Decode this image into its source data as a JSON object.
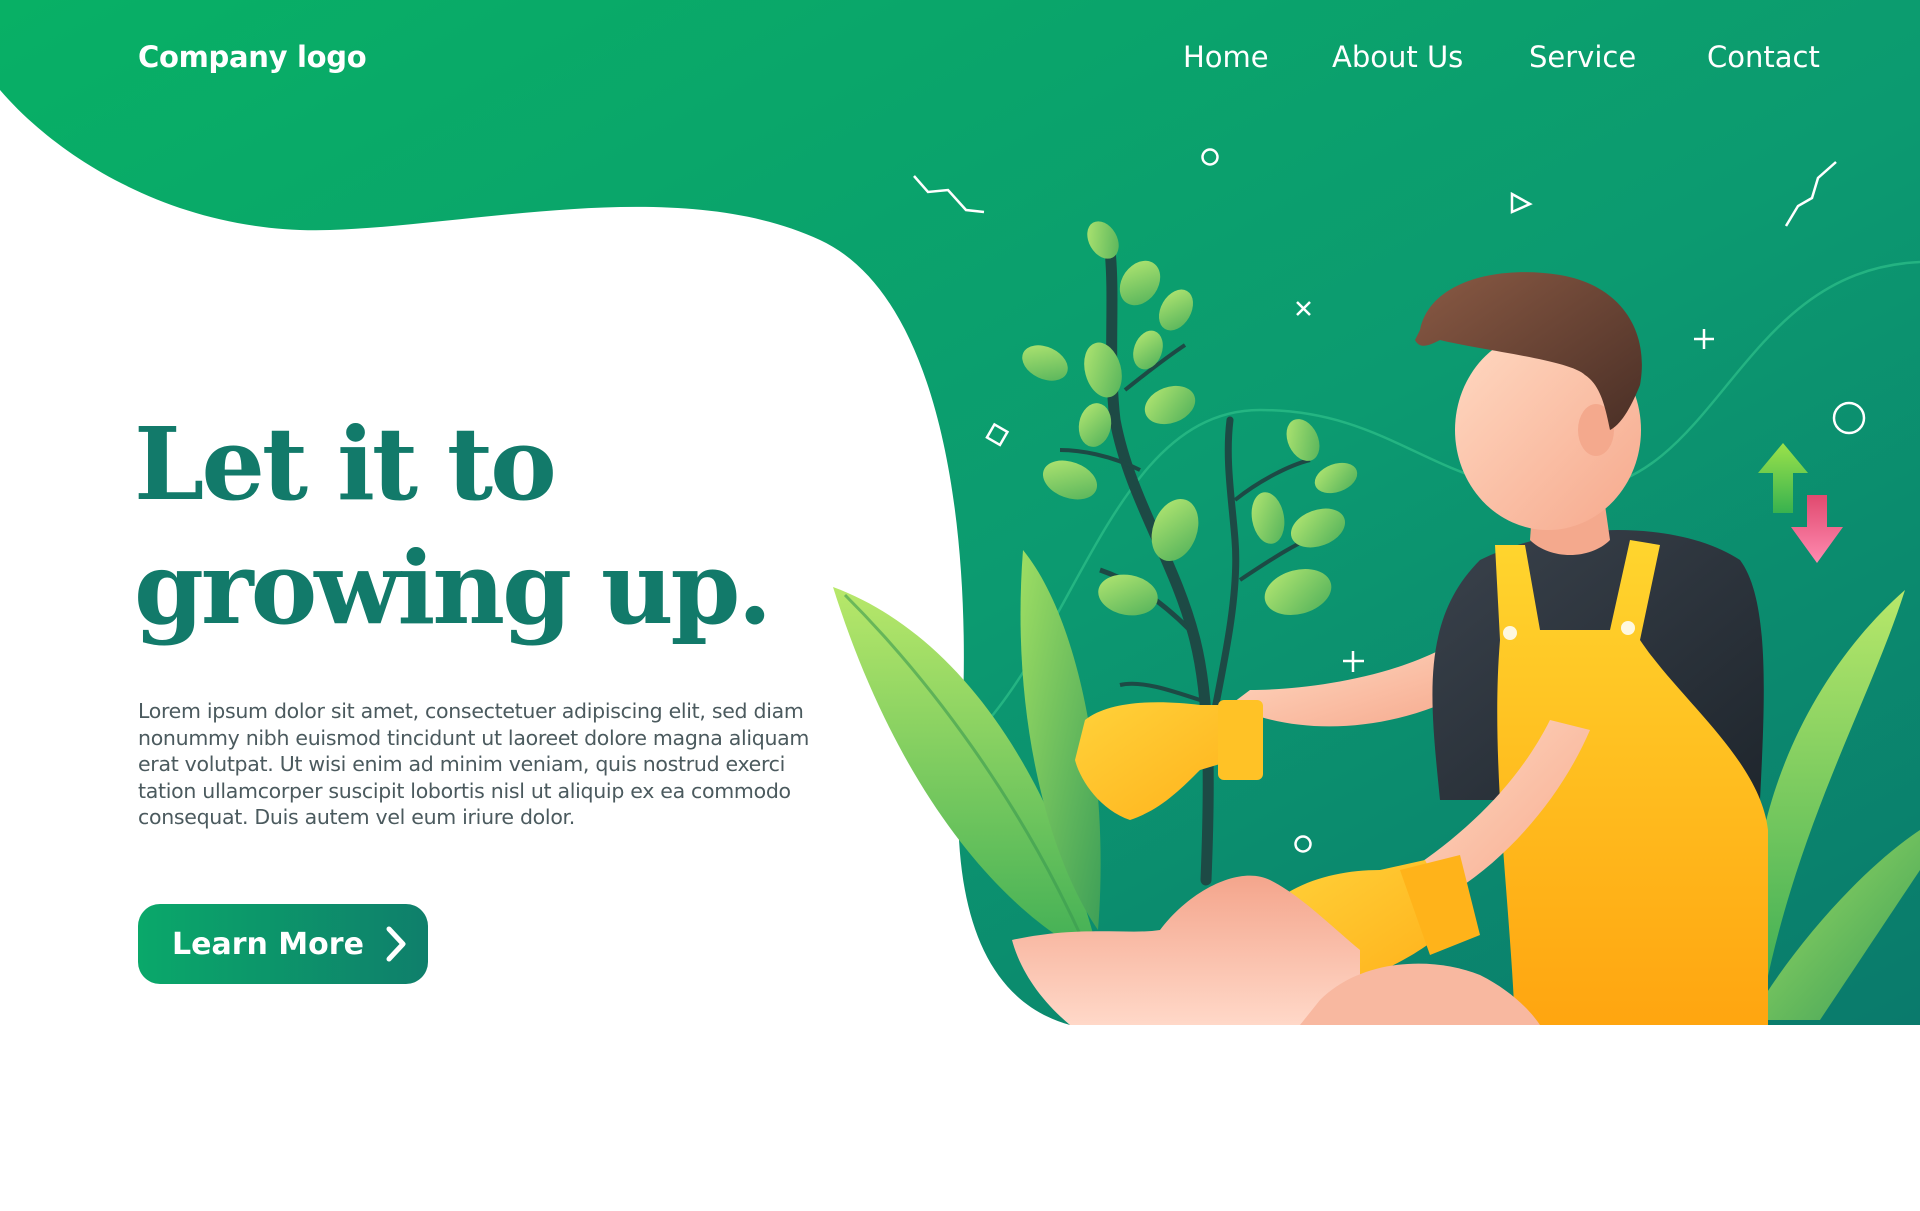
{
  "header": {
    "logo": "Company logo",
    "nav": [
      {
        "label": "Home"
      },
      {
        "label": "About Us"
      },
      {
        "label": "Service"
      },
      {
        "label": "Contact"
      }
    ]
  },
  "hero": {
    "title_line1": "Let it to",
    "title_line2": "growing up.",
    "body": "Lorem ipsum dolor sit amet, consectetuer adipiscing elit, sed diam nonummy nibh euismod tincidunt ut laoreet dolore magna aliquam erat volutpat. Ut wisi enim ad minim veniam, quis nostrud exerci tation ullamcorper suscipit lobortis nisl ut aliquip ex ea commodo consequat. Duis autem vel eum iriure dolor.",
    "cta_label": "Learn More",
    "cta_icon": "chevron-right-icon"
  },
  "illustration": {
    "subject": "gardener-planting-tree",
    "icons": [
      "arrow-up-icon",
      "arrow-down-icon"
    ]
  },
  "colors": {
    "primary_green": "#0aa86a",
    "deep_teal": "#0f7f6b",
    "title_teal": "#127a6a",
    "body_text": "#4b5a5e",
    "apron_yellow": "#ffc21a",
    "arrow_pink": "#f0709a",
    "leaf_green": "#8fd25a"
  }
}
